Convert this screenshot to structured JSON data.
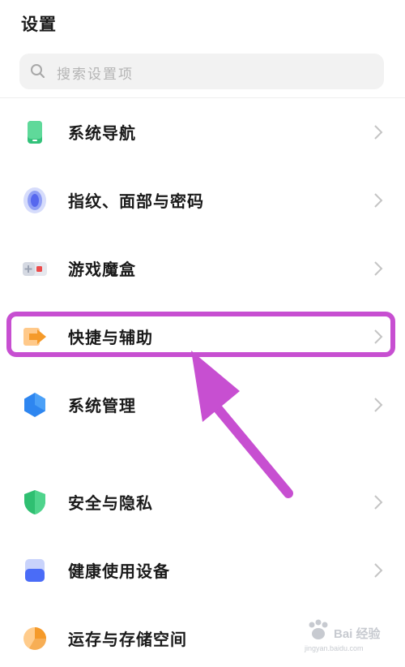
{
  "header": {
    "title": "设置"
  },
  "search": {
    "placeholder": "搜索设置项",
    "icon": "search-icon"
  },
  "settings_items": [
    {
      "label": "系统导航",
      "icon": "phone-navigation-icon",
      "color": "#2fbf71"
    },
    {
      "label": "指纹、面部与密码",
      "icon": "fingerprint-icon",
      "color": "#5b6ff0"
    },
    {
      "label": "游戏魔盒",
      "icon": "game-box-icon",
      "color": "#e84a4a"
    },
    {
      "label": "快捷与辅助",
      "icon": "shortcut-arrow-icon",
      "color": "#f59a2a"
    },
    {
      "label": "系统管理",
      "icon": "hexagon-icon",
      "color": "#2e86f0"
    },
    {
      "label": "安全与隐私",
      "icon": "shield-icon",
      "color": "#2fbf71"
    },
    {
      "label": "健康使用设备",
      "icon": "health-device-icon",
      "color": "#4a6cf7"
    },
    {
      "label": "运存与存储空间",
      "icon": "storage-pie-icon",
      "color": "#f59a2a"
    }
  ],
  "annotation": {
    "highlight_color": "#c74fd1",
    "highlighted_item": "快捷与辅助"
  },
  "watermark": {
    "text": "Bai 经验",
    "sub": "jingyan.baidu.com"
  }
}
